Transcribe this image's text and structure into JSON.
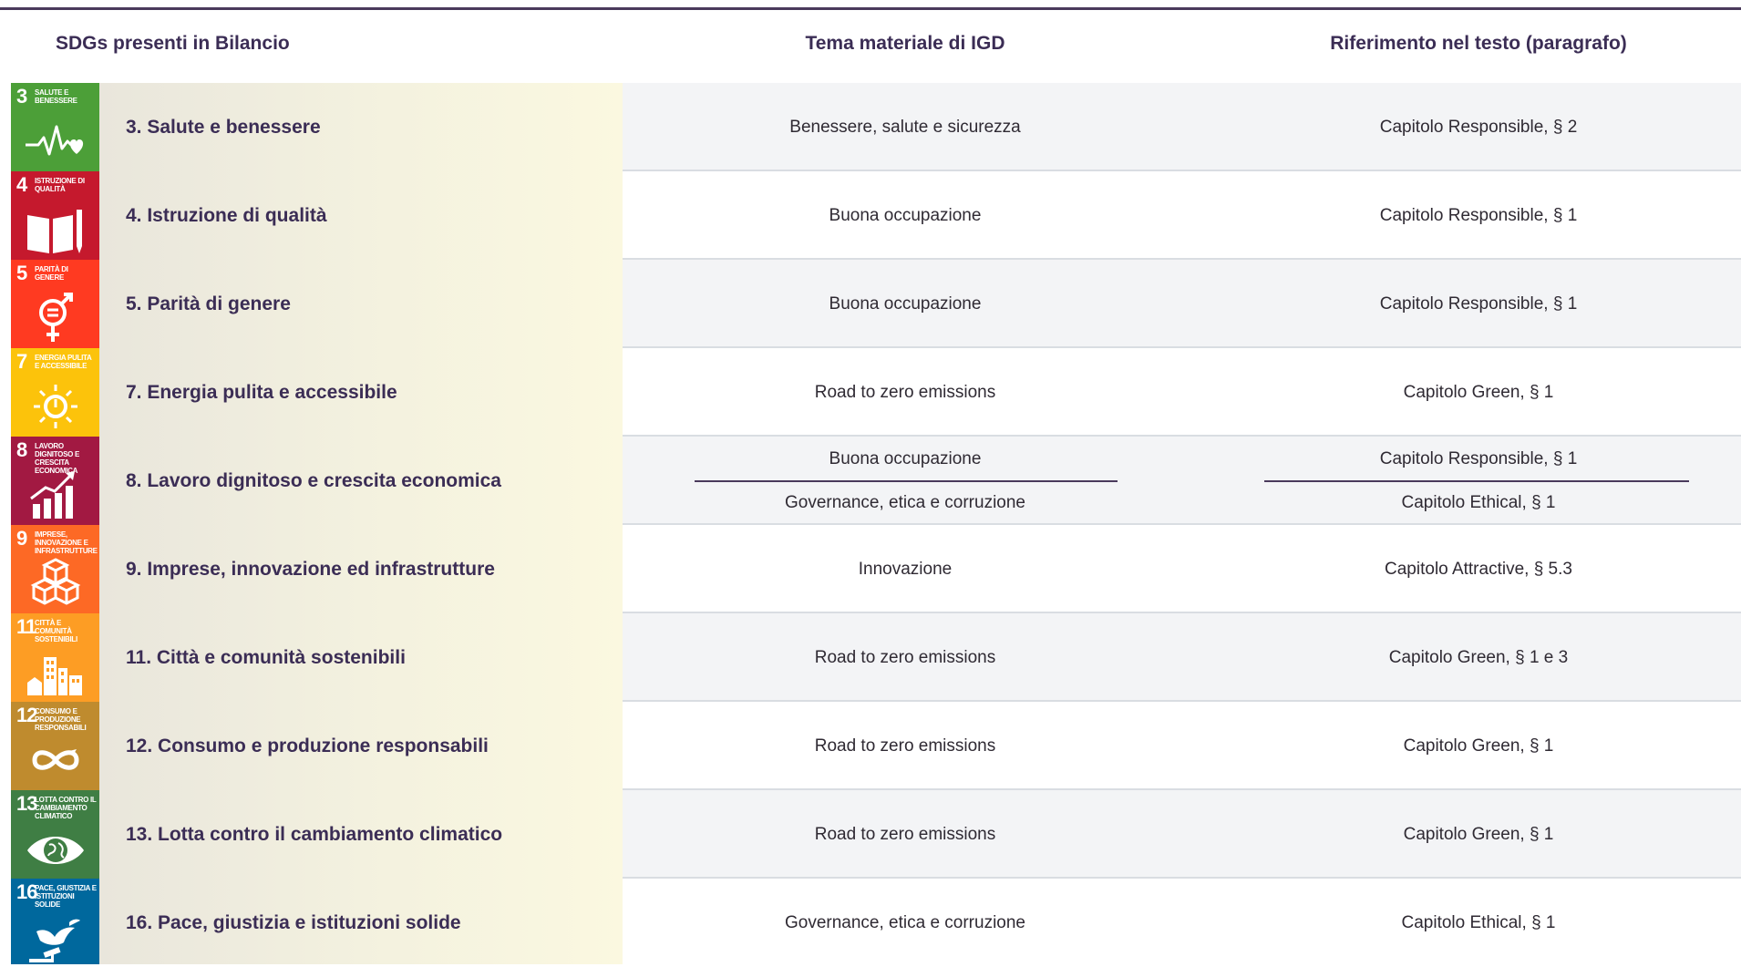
{
  "headers": {
    "col1": "SDGs presenti in Bilancio",
    "col2": "Tema materiale di IGD",
    "col3": "Riferimento nel testo (paragrafo)"
  },
  "rows": [
    {
      "num": "3",
      "tile_title": "SALUTE E BENESSERE",
      "color": "#4c9f38",
      "icon": "heartbeat-icon",
      "label": "3. Salute e benessere",
      "theme": "Benessere, salute e sicurezza",
      "ref": "Capitolo Responsible, § 2"
    },
    {
      "num": "4",
      "tile_title": "ISTRUZIONE DI QUALITÀ",
      "color": "#c5192d",
      "icon": "book-pencil-icon",
      "label": "4. Istruzione di qualità",
      "theme": "Buona occupazione",
      "ref": "Capitolo Responsible, § 1"
    },
    {
      "num": "5",
      "tile_title": "PARITÀ DI GENERE",
      "color": "#ff3a21",
      "icon": "gender-equality-icon",
      "label": "5. Parità di genere",
      "theme": "Buona occupazione",
      "ref": "Capitolo Responsible, § 1"
    },
    {
      "num": "7",
      "tile_title": "ENERGIA PULITA E ACCESSIBILE",
      "color": "#fcc30b",
      "icon": "sun-power-icon",
      "label": "7. Energia pulita e accessibile",
      "theme": "Road to zero emissions",
      "ref": "Capitolo Green, § 1"
    },
    {
      "num": "8",
      "tile_title": "LAVORO DIGNITOSO E CRESCITA ECONOMICA",
      "color": "#a21942",
      "icon": "growth-chart-icon",
      "label": "8. Lavoro dignitoso e crescita economica",
      "theme": "Buona occupazione",
      "ref": "Capitolo Responsible, § 1",
      "theme2": "Governance, etica e corruzione",
      "ref2": "Capitolo Ethical, § 1"
    },
    {
      "num": "9",
      "tile_title": "IMPRESE, INNOVAZIONE E INFRASTRUTTURE",
      "color": "#fd6925",
      "icon": "cubes-icon",
      "label": "9. Imprese, innovazione ed infrastrutture",
      "theme": "Innovazione",
      "ref": "Capitolo Attractive, § 5.3"
    },
    {
      "num": "11",
      "tile_title": "CITTÀ E COMUNITÀ SOSTENIBILI",
      "color": "#fd9d24",
      "icon": "city-icon",
      "label": "11. Città e comunità sostenibili",
      "theme": "Road to zero emissions",
      "ref": "Capitolo Green, § 1 e 3"
    },
    {
      "num": "12",
      "tile_title": "CONSUMO E PRODUZIONE RESPONSABILI",
      "color": "#bf8b2e",
      "icon": "infinity-icon",
      "label": "12. Consumo e produzione responsabili",
      "theme": "Road to zero emissions",
      "ref": "Capitolo Green, § 1"
    },
    {
      "num": "13",
      "tile_title": "LOTTA CONTRO IL CAMBIAMENTO CLIMATICO",
      "color": "#3f7e44",
      "icon": "earth-eye-icon",
      "label": "13. Lotta contro il cambiamento climatico",
      "theme": "Road to zero emissions",
      "ref": "Capitolo Green, § 1"
    },
    {
      "num": "16",
      "tile_title": "PACE, GIUSTIZIA E ISTITUZIONI SOLIDE",
      "color": "#00689d",
      "icon": "dove-gavel-icon",
      "label": "16. Pace, giustizia e istituzioni solide",
      "theme": "Governance, etica e corruzione",
      "ref": "Capitolo Ethical, § 1"
    }
  ]
}
